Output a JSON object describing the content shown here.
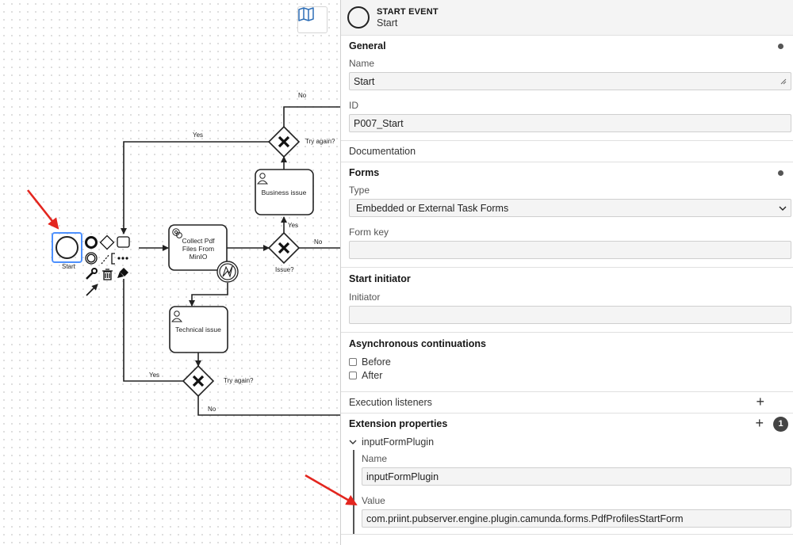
{
  "canvas": {
    "labels": {
      "start": "Start",
      "collect_task": [
        "Collect Pdf",
        "Files From",
        "MinIO"
      ],
      "business_issue": "Business issue",
      "technical_issue": "Technical issue",
      "try_again_top": "Try again?",
      "try_again_bottom": "Try again?",
      "issue": "Issue?",
      "yes_top": "Yes",
      "yes_middle": "Yes",
      "yes_bottom": "Yes",
      "no_top": "No",
      "no_middle": "No",
      "no_bottom": "No"
    },
    "icons": {
      "minimap": "map-icon",
      "context_pad": [
        "end-event-icon",
        "gateway-icon",
        "task-icon",
        "intermediate-event-icon",
        "text-annotation-icon",
        "more-icon",
        "wrench-icon",
        "trash-icon",
        "color-brush-icon",
        "connect-arrow-icon"
      ]
    },
    "colors": {
      "selection": "#4d90fe",
      "annotation_arrow": "#e3261f",
      "stroke": "#222222"
    }
  },
  "panel": {
    "header": {
      "type": "START EVENT",
      "name": "Start"
    },
    "general": {
      "title": "General",
      "name_label": "Name",
      "name_value": "Start",
      "id_label": "ID",
      "id_value": "P007_Start"
    },
    "documentation": {
      "title": "Documentation"
    },
    "forms": {
      "title": "Forms",
      "type_label": "Type",
      "type_value": "Embedded or External Task Forms",
      "form_key_label": "Form key",
      "form_key_value": ""
    },
    "start_initiator": {
      "title": "Start initiator",
      "initiator_label": "Initiator",
      "initiator_value": ""
    },
    "async": {
      "title": "Asynchronous continuations",
      "before_label": "Before",
      "after_label": "After"
    },
    "execution_listeners": {
      "title": "Execution listeners"
    },
    "extension_properties": {
      "title": "Extension properties",
      "count": "1",
      "item": {
        "title": "inputFormPlugin",
        "name_label": "Name",
        "name_value": "inputFormPlugin",
        "value_label": "Value",
        "value_value": "com.priint.pubserver.engine.plugin.camunda.forms.PdfProfilesStartForm"
      }
    }
  }
}
